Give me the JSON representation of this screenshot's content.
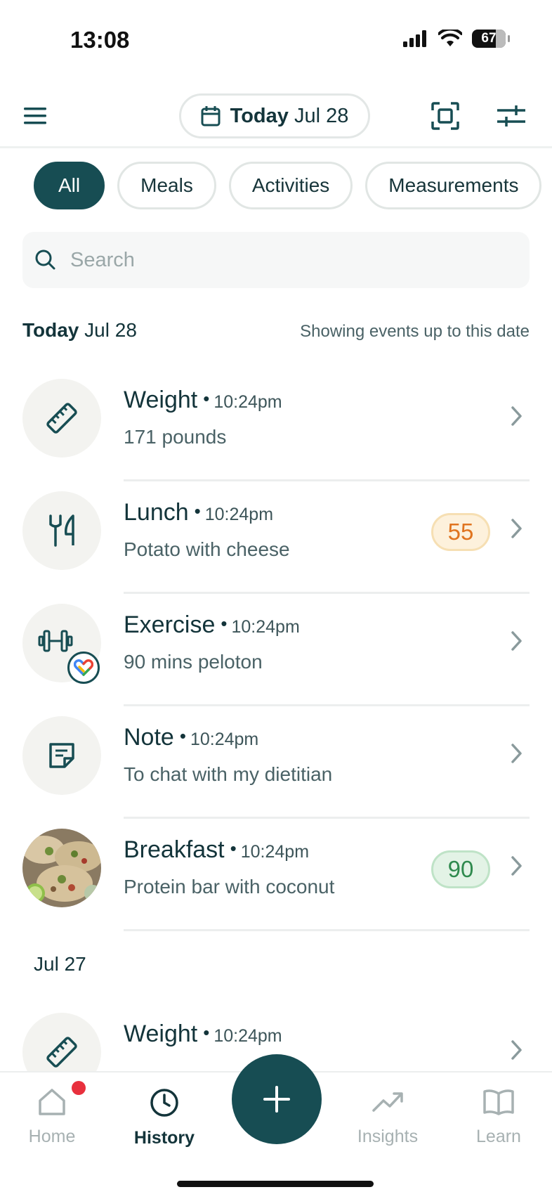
{
  "status_bar": {
    "time": "13:08",
    "battery": "67"
  },
  "header": {
    "date_today": "Today",
    "date_value": "Jul 28"
  },
  "filters": [
    {
      "label": "All",
      "active": true
    },
    {
      "label": "Meals",
      "active": false
    },
    {
      "label": "Activities",
      "active": false
    },
    {
      "label": "Measurements",
      "active": false
    }
  ],
  "search": {
    "placeholder": "Search"
  },
  "section_today": {
    "title_bold": "Today",
    "title_date": "Jul 28",
    "note": "Showing events up to this date"
  },
  "entries": [
    {
      "title": "Weight",
      "time": "10:24pm",
      "subtitle": "171 pounds",
      "icon": "ruler-icon"
    },
    {
      "title": "Lunch",
      "time": "10:24pm",
      "subtitle": "Potato with cheese",
      "icon": "fork-knife-icon",
      "score": "55",
      "score_color": "#e0741f"
    },
    {
      "title": "Exercise",
      "time": "10:24pm",
      "subtitle": "90 mins peloton",
      "icon": "dumbbell-icon",
      "source_icon": "google-fit-icon"
    },
    {
      "title": "Note",
      "time": "10:24pm",
      "subtitle": "To chat with my dietitian",
      "icon": "note-icon"
    },
    {
      "title": "Breakfast",
      "time": "10:24pm",
      "subtitle": "Protein bar with coconut",
      "icon": "food-photo",
      "score": "90",
      "score_color": "#2f8a4e"
    }
  ],
  "section_jul27": {
    "title": "Jul 27"
  },
  "entries_jul27": [
    {
      "title": "Weight",
      "time": "10:24pm",
      "icon": "ruler-icon"
    }
  ],
  "bottom_nav": [
    {
      "label": "Home",
      "icon": "home-icon",
      "active": false
    },
    {
      "label": "History",
      "icon": "clock-icon",
      "active": true
    },
    {
      "label": "Insights",
      "icon": "trend-icon",
      "active": false
    },
    {
      "label": "Learn",
      "icon": "book-icon",
      "active": false
    }
  ],
  "colors": {
    "primary": "#174d53",
    "text": "#13343a",
    "notification": "#e8303d"
  }
}
